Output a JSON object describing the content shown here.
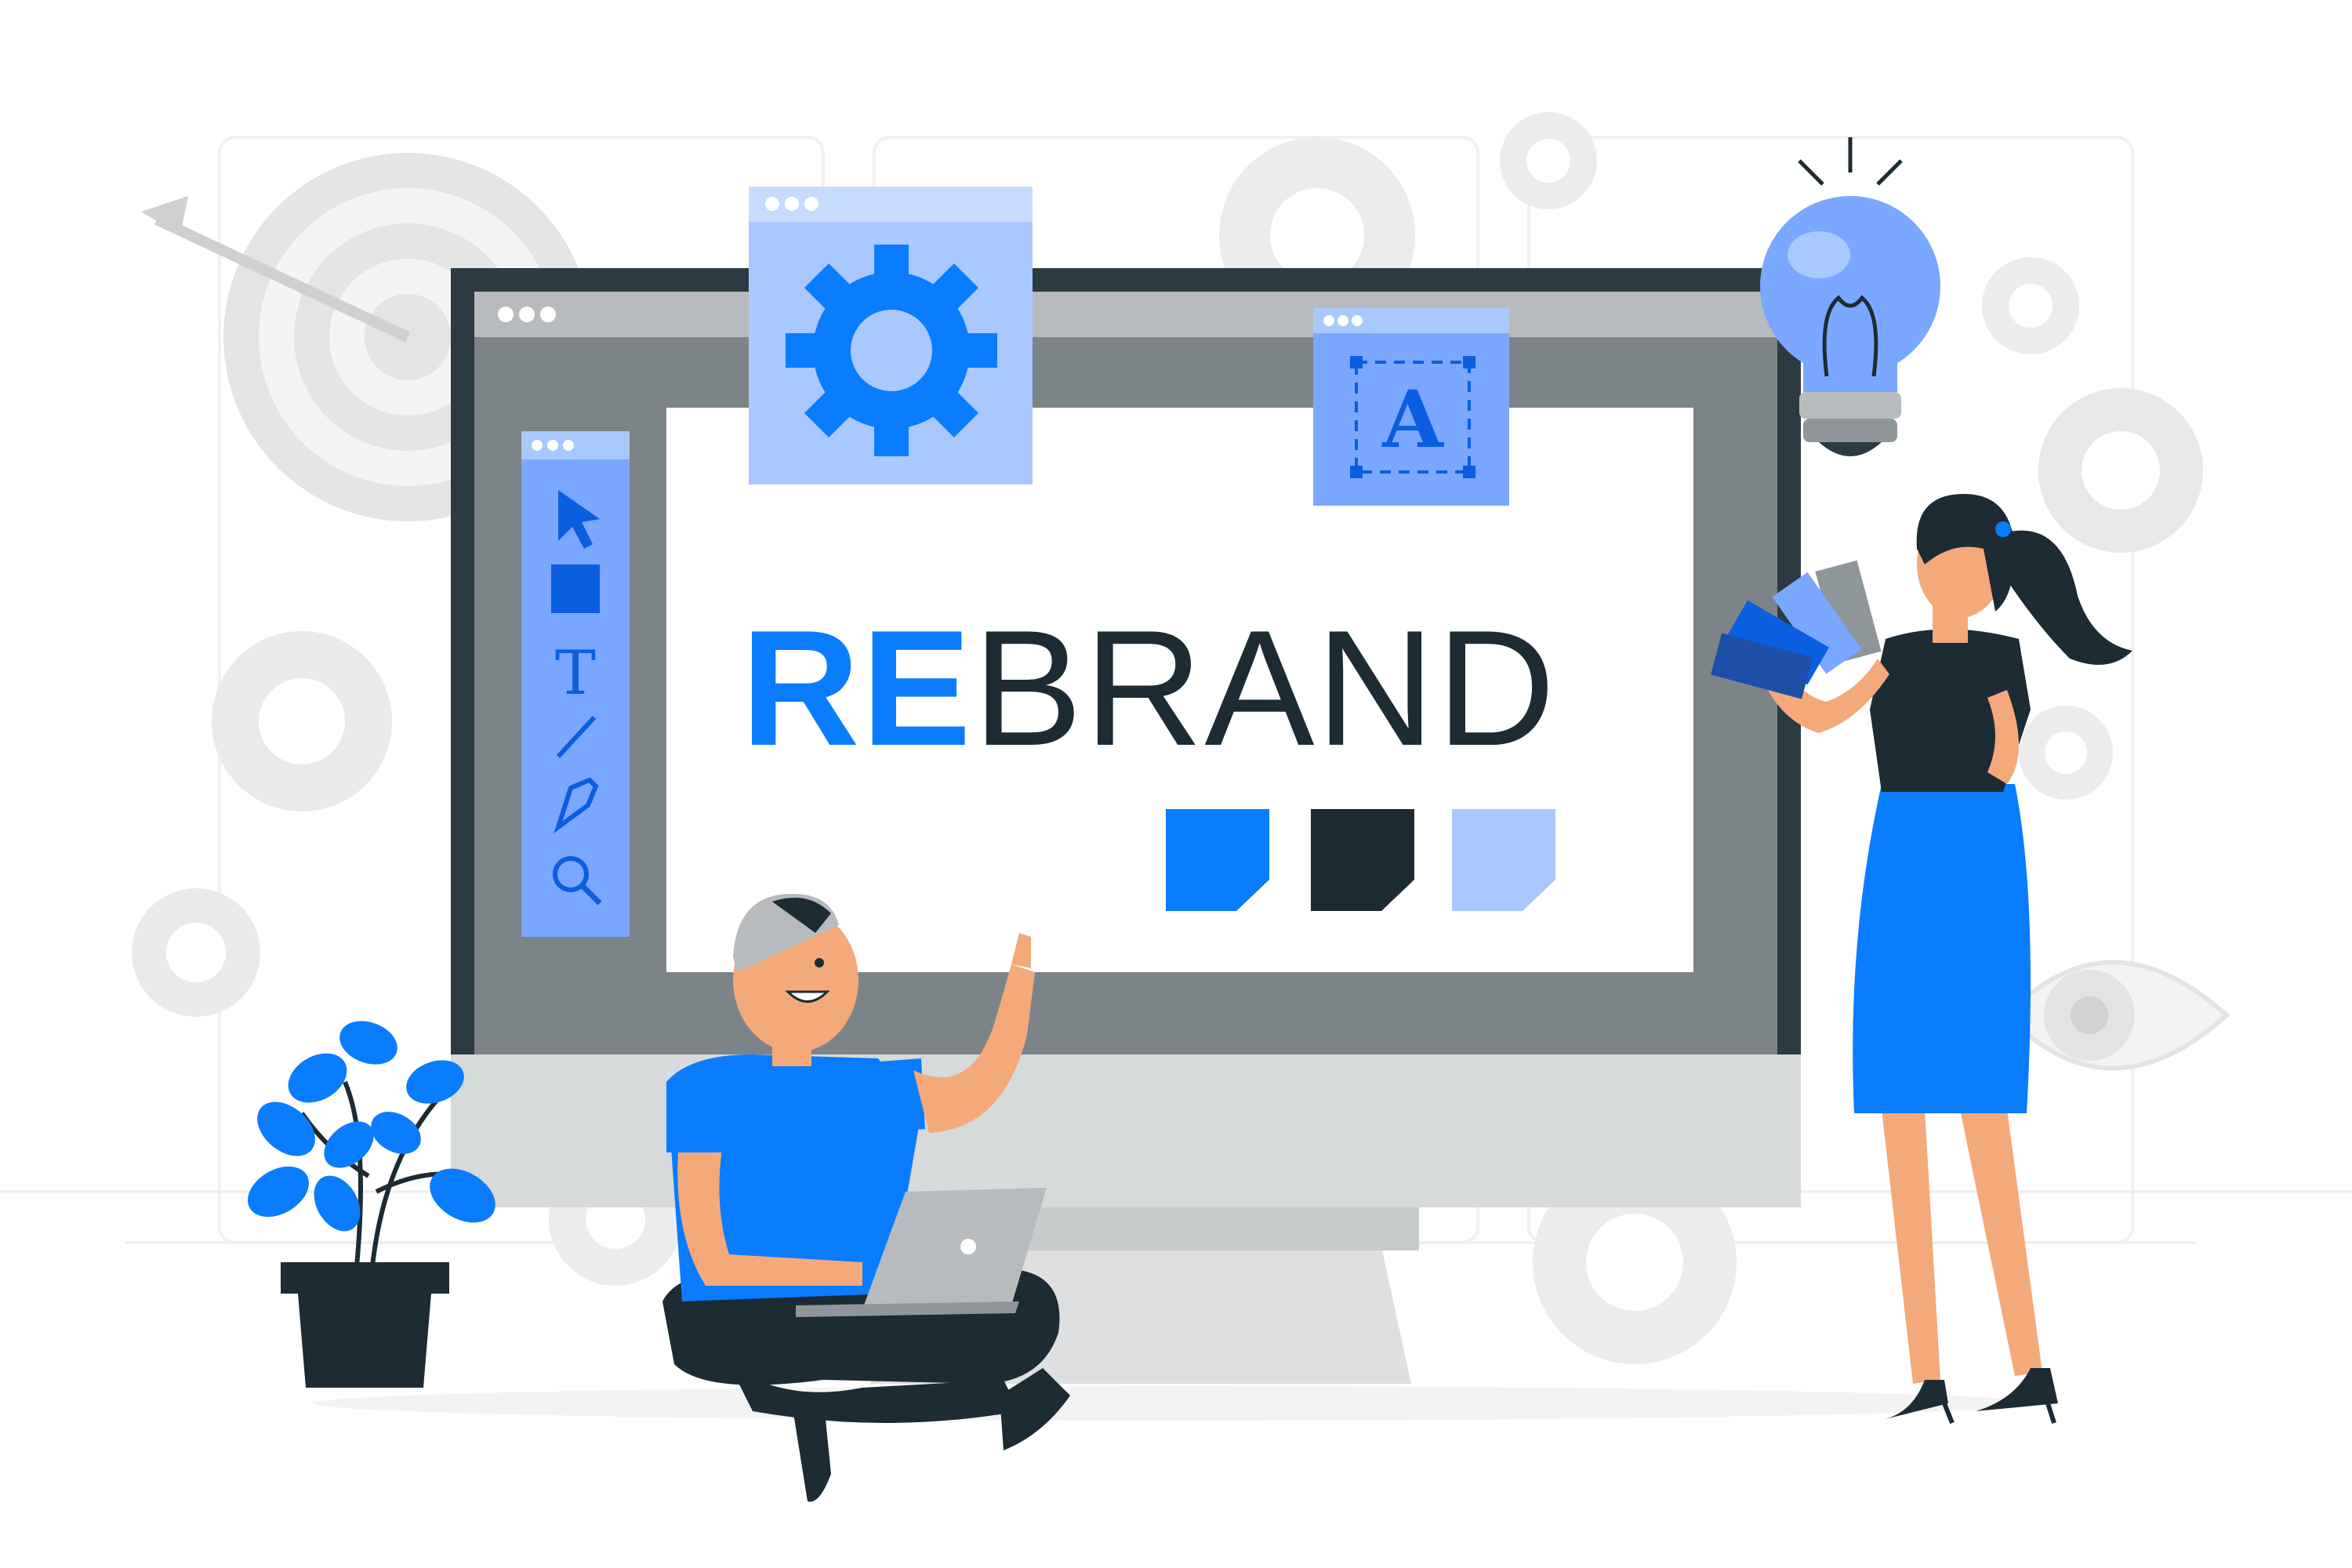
{
  "headline": {
    "highlight": "RE",
    "rest": "BRAND"
  },
  "toolbar": {
    "text_tool_glyph": "T"
  },
  "font_window": {
    "glyph": "A"
  },
  "colors": {
    "brand_blue": "#0a7cff",
    "dark": "#1d2b33",
    "light_blue": "#a9c8ff",
    "mid_blue": "#7aa7ff",
    "monitor_frame": "#2c3a42",
    "monitor_gray": "#7d8487",
    "stand_light": "#d7dadb",
    "decor_gray": "#ececec"
  },
  "swatches": [
    {
      "color": "#0a7cff"
    },
    {
      "color": "#1d2b33"
    },
    {
      "color": "#a9c8ff"
    }
  ]
}
